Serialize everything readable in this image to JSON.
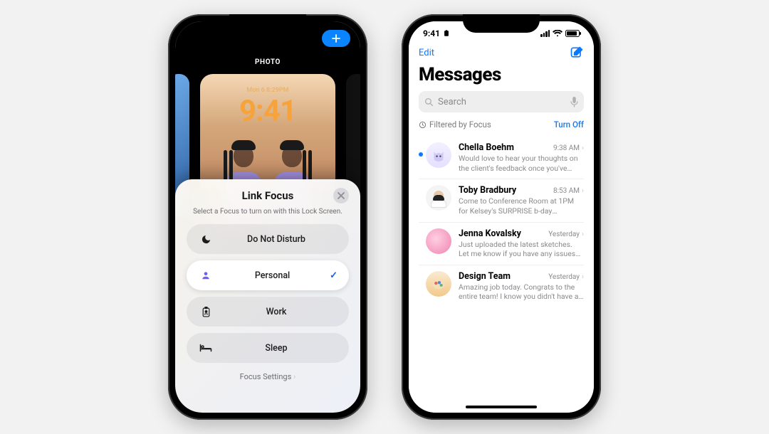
{
  "status": {
    "time": "9:41"
  },
  "phoneA": {
    "title": "PHOTO",
    "lock_date": "Mon 6  8:29PM",
    "lock_time": "9:41",
    "sheet": {
      "title": "Link Focus",
      "subtitle": "Select a Focus to turn on with this Lock Screen.",
      "items": [
        {
          "icon": "moon",
          "label": "Do Not Disturb",
          "selected": false
        },
        {
          "icon": "person",
          "label": "Personal",
          "selected": true
        },
        {
          "icon": "badge",
          "label": "Work",
          "selected": false
        },
        {
          "icon": "bed",
          "label": "Sleep",
          "selected": false
        }
      ],
      "settings_label": "Focus Settings"
    }
  },
  "phoneB": {
    "nav_edit": "Edit",
    "title": "Messages",
    "search_placeholder": "Search",
    "focus_filter": {
      "label": "Filtered by Focus",
      "action": "Turn Off"
    },
    "threads": [
      {
        "unread": true,
        "name": "Chella Boehm",
        "time": "9:38 AM",
        "preview": "Would love to hear your thoughts on the client's feedback once you've finished th…"
      },
      {
        "unread": false,
        "name": "Toby Bradbury",
        "time": "8:53 AM",
        "preview": "Come to Conference Room at 1PM for Kelsey's SURPRISE b-day celebration."
      },
      {
        "unread": false,
        "name": "Jenna Kovalsky",
        "time": "Yesterday",
        "preview": "Just uploaded the latest sketches. Let me know if you have any issues accessing."
      },
      {
        "unread": false,
        "name": "Design Team",
        "time": "Yesterday",
        "preview": "Amazing job today. Congrats to the entire team! I know you didn't have a lot of tim…"
      }
    ]
  }
}
